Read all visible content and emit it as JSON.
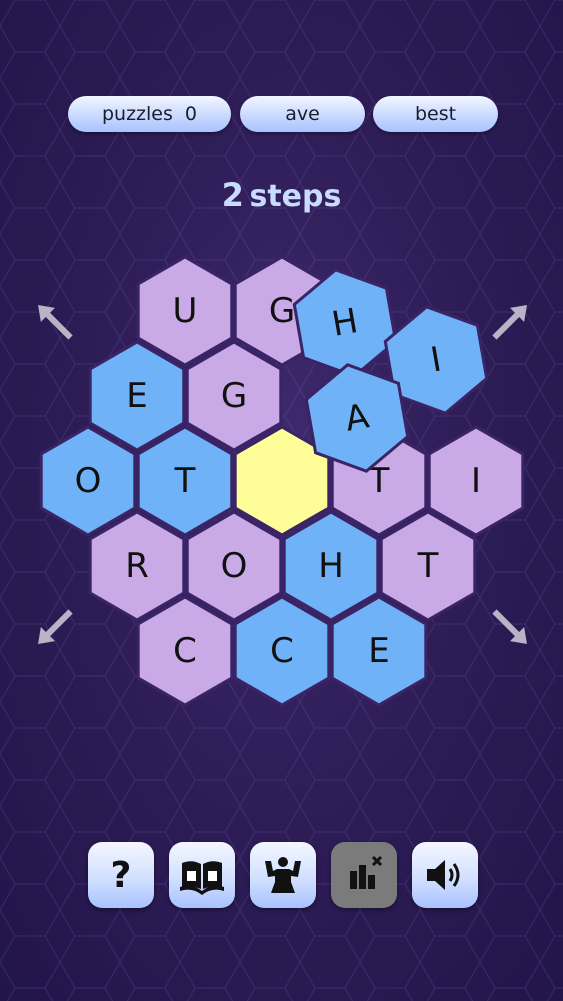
{
  "header": {
    "puzzles_label": "puzzles",
    "puzzles_value": "0",
    "ave_label": "ave",
    "best_label": "best"
  },
  "status": {
    "steps_count": "2",
    "steps_label": "steps"
  },
  "board": {
    "tiles": [
      {
        "letter": "U",
        "color": "purple"
      },
      {
        "letter": "G",
        "color": "purple"
      },
      {
        "letter": "E",
        "color": "blue"
      },
      {
        "letter": "G",
        "color": "purple"
      },
      {
        "letter": "O",
        "color": "blue"
      },
      {
        "letter": "T",
        "color": "blue"
      },
      {
        "letter": "",
        "color": "yellow"
      },
      {
        "letter": "T",
        "color": "purple"
      },
      {
        "letter": "I",
        "color": "purple"
      },
      {
        "letter": "R",
        "color": "purple"
      },
      {
        "letter": "O",
        "color": "purple"
      },
      {
        "letter": "H",
        "color": "blue"
      },
      {
        "letter": "T",
        "color": "purple"
      },
      {
        "letter": "C",
        "color": "purple"
      },
      {
        "letter": "C",
        "color": "blue"
      },
      {
        "letter": "E",
        "color": "blue"
      }
    ],
    "floating_tiles": [
      {
        "letter": "H",
        "color": "blue"
      },
      {
        "letter": "I",
        "color": "blue"
      },
      {
        "letter": "A",
        "color": "blue"
      }
    ],
    "rotate_arrows": [
      "rotate-arrow-top-left",
      "rotate-arrow-top-right",
      "rotate-arrow-bottom-left",
      "rotate-arrow-bottom-right"
    ]
  },
  "colors": {
    "purple": "#c9a9e6",
    "blue": "#6fb2f7",
    "yellow": "#fffd97",
    "hex_border": "#3a2466",
    "arrow": "#b9b3c6"
  },
  "toolbar": {
    "buttons": [
      {
        "name": "help-button",
        "icon": "question-icon"
      },
      {
        "name": "dictionary-button",
        "icon": "dictionary-icon"
      },
      {
        "name": "strength-button",
        "icon": "strongman-icon"
      },
      {
        "name": "stats-button",
        "icon": "stats-off-icon",
        "disabled": true
      },
      {
        "name": "sound-button",
        "icon": "speaker-icon"
      }
    ]
  }
}
